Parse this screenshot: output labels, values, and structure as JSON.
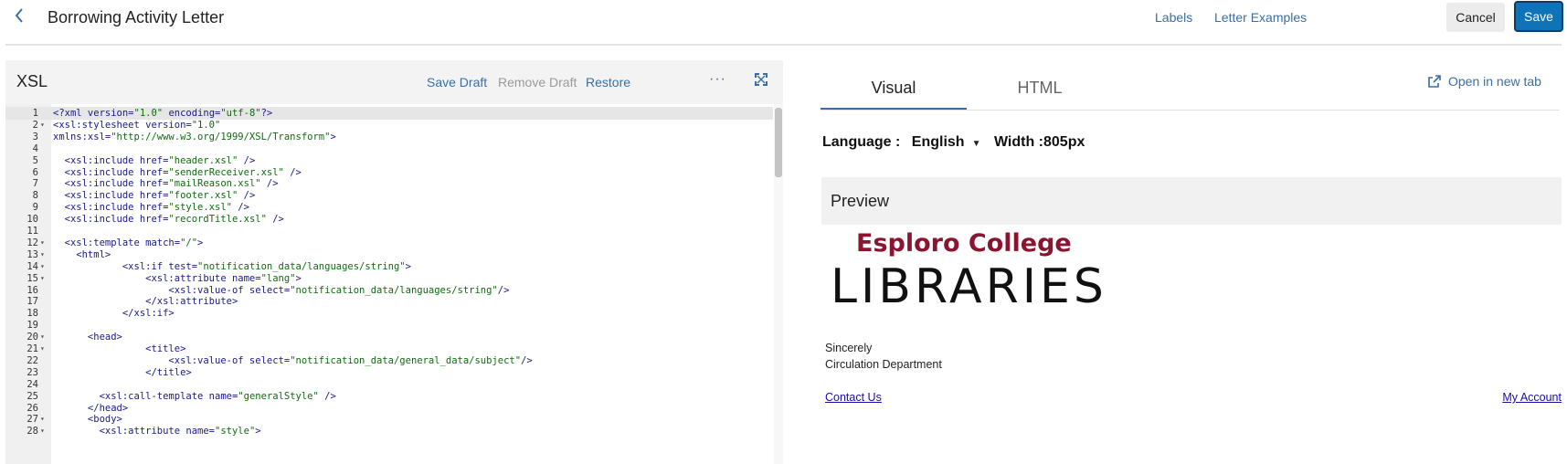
{
  "header": {
    "title": "Borrowing Activity Letter",
    "back_icon": "chevron-left-icon",
    "links": [
      "Labels",
      "Letter Examples"
    ],
    "cancel_label": "Cancel",
    "save_label": "Save"
  },
  "editor": {
    "title": "XSL",
    "toolbar": {
      "save_draft": "Save Draft",
      "remove_draft": "Remove Draft",
      "restore": "Restore",
      "more": "···"
    },
    "lines": [
      {
        "n": "1",
        "fold": "",
        "t": "<?xml version=\"1.0\" encoding=\"utf-8\"?>"
      },
      {
        "n": "2",
        "fold": "▾",
        "t": "<xsl:stylesheet version=\"1.0\""
      },
      {
        "n": "3",
        "fold": "",
        "t": "xmlns:xsl=\"http://www.w3.org/1999/XSL/Transform\">"
      },
      {
        "n": "4",
        "fold": "",
        "t": ""
      },
      {
        "n": "5",
        "fold": "",
        "t": "  <xsl:include href=\"header.xsl\" />"
      },
      {
        "n": "6",
        "fold": "",
        "t": "  <xsl:include href=\"senderReceiver.xsl\" />"
      },
      {
        "n": "7",
        "fold": "",
        "t": "  <xsl:include href=\"mailReason.xsl\" />"
      },
      {
        "n": "8",
        "fold": "",
        "t": "  <xsl:include href=\"footer.xsl\" />"
      },
      {
        "n": "9",
        "fold": "",
        "t": "  <xsl:include href=\"style.xsl\" />"
      },
      {
        "n": "10",
        "fold": "",
        "t": "  <xsl:include href=\"recordTitle.xsl\" />"
      },
      {
        "n": "11",
        "fold": "",
        "t": ""
      },
      {
        "n": "12",
        "fold": "▾",
        "t": "  <xsl:template match=\"/\">"
      },
      {
        "n": "13",
        "fold": "▾",
        "t": "    <html>"
      },
      {
        "n": "14",
        "fold": "▾",
        "t": "            <xsl:if test=\"notification_data/languages/string\">"
      },
      {
        "n": "15",
        "fold": "▾",
        "t": "                <xsl:attribute name=\"lang\">"
      },
      {
        "n": "16",
        "fold": "",
        "t": "                    <xsl:value-of select=\"notification_data/languages/string\"/>"
      },
      {
        "n": "17",
        "fold": "",
        "t": "                </xsl:attribute>"
      },
      {
        "n": "18",
        "fold": "",
        "t": "            </xsl:if>"
      },
      {
        "n": "19",
        "fold": "",
        "t": ""
      },
      {
        "n": "20",
        "fold": "▾",
        "t": "      <head>"
      },
      {
        "n": "21",
        "fold": "▾",
        "t": "                <title>"
      },
      {
        "n": "22",
        "fold": "",
        "t": "                    <xsl:value-of select=\"notification_data/general_data/subject\"/>"
      },
      {
        "n": "23",
        "fold": "",
        "t": "                </title>"
      },
      {
        "n": "24",
        "fold": "",
        "t": ""
      },
      {
        "n": "25",
        "fold": "",
        "t": "        <xsl:call-template name=\"generalStyle\" />"
      },
      {
        "n": "26",
        "fold": "",
        "t": "      </head>"
      },
      {
        "n": "27",
        "fold": "▾",
        "t": "      <body>"
      },
      {
        "n": "28",
        "fold": "▾",
        "t": "        <xsl:attribute name=\"style\">"
      }
    ]
  },
  "preview": {
    "tabs": [
      "Visual",
      "HTML"
    ],
    "open_new_tab": "Open in new tab",
    "language_label": "Language :",
    "language_value": "English",
    "width_label": "Width :805px",
    "section_title": "Preview",
    "logo_line1": "Esploro College",
    "logo_line2": "LIBRARIES",
    "sincerely": "Sincerely",
    "department": "Circulation Department",
    "contact_us": "Contact Us",
    "my_account": "My Account"
  },
  "colors": {
    "accent": "#3a6ea5",
    "save": "#0f73b8",
    "brand": "#8a1530"
  }
}
